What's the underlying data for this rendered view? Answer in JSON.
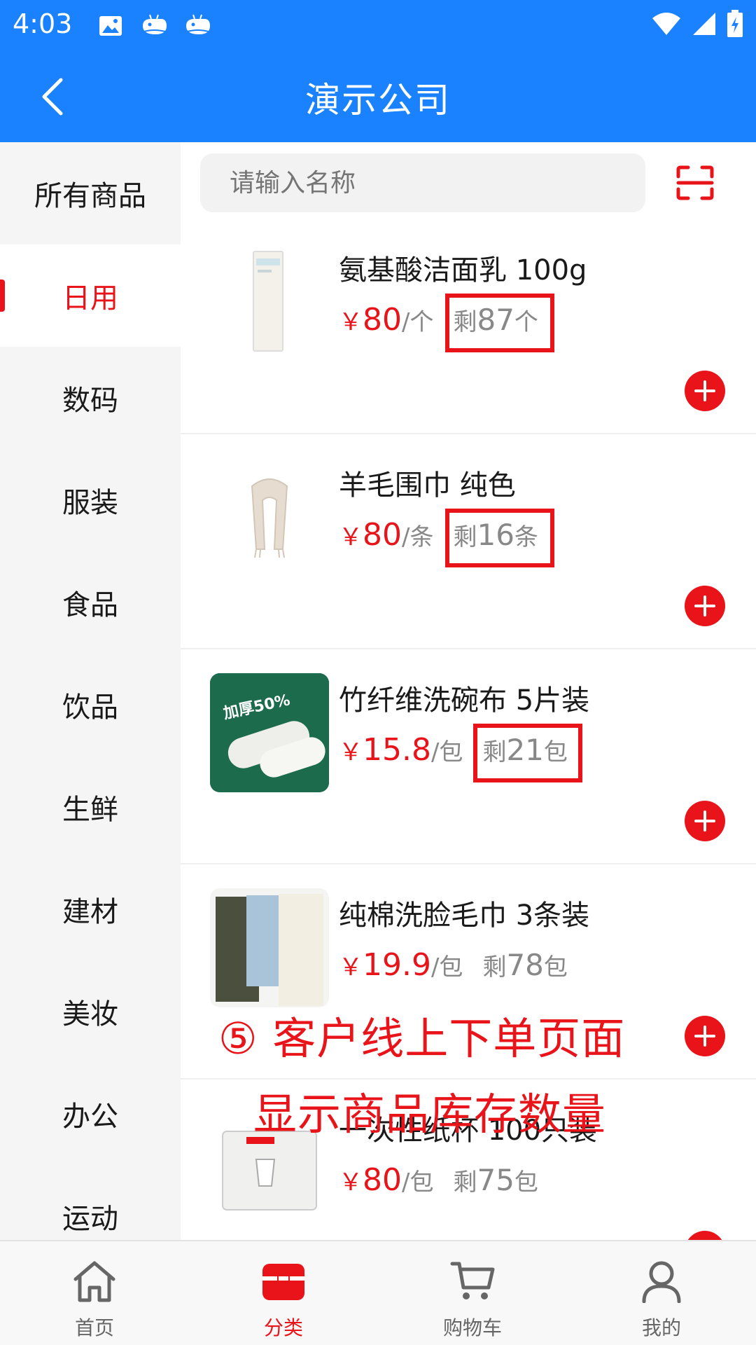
{
  "status_bar": {
    "time": "4:03"
  },
  "header": {
    "title": "演示公司"
  },
  "sidebar": {
    "items": [
      {
        "label": "所有商品",
        "active": false
      },
      {
        "label": "日用",
        "active": true
      },
      {
        "label": "数码",
        "active": false
      },
      {
        "label": "服装",
        "active": false
      },
      {
        "label": "食品",
        "active": false
      },
      {
        "label": "饮品",
        "active": false
      },
      {
        "label": "生鲜",
        "active": false
      },
      {
        "label": "建材",
        "active": false
      },
      {
        "label": "美妆",
        "active": false
      },
      {
        "label": "办公",
        "active": false
      },
      {
        "label": "运动",
        "active": false
      }
    ]
  },
  "search": {
    "placeholder": "请输入名称"
  },
  "products": [
    {
      "name": "氨基酸洁面乳 100g",
      "currency": "￥",
      "price": "80",
      "unit": "/个",
      "stock_prefix": "剩",
      "stock_num": "87",
      "stock_unit": "个",
      "image": "cleanser-tube"
    },
    {
      "name": "羊毛围巾 纯色",
      "currency": "￥",
      "price": "80",
      "unit": "/条",
      "stock_prefix": "剩",
      "stock_num": "16",
      "stock_unit": "条",
      "image": "scarf"
    },
    {
      "name": "竹纤维洗碗布 5片装",
      "currency": "￥",
      "price": "15.8",
      "unit": "/包",
      "stock_prefix": "剩",
      "stock_num": "21",
      "stock_unit": "包",
      "image": "dish-cloth",
      "image_text": "加厚50%"
    },
    {
      "name": "纯棉洗脸毛巾 3条装",
      "currency": "￥",
      "price": "19.9",
      "unit": "/包",
      "stock_prefix": "剩",
      "stock_num": "78",
      "stock_unit": "包",
      "image": "towels"
    },
    {
      "name": "一次性纸杯 100只装",
      "currency": "￥",
      "price": "80",
      "unit": "/包",
      "stock_prefix": "剩",
      "stock_num": "75",
      "stock_unit": "包",
      "image": "paper-cups"
    }
  ],
  "annotation": {
    "line1": "⑤ 客户线上下单页面",
    "line2": "显示商品库存数量",
    "color": "#e8141a"
  },
  "tabbar": {
    "items": [
      {
        "label": "首页",
        "icon": "home-icon",
        "active": false
      },
      {
        "label": "分类",
        "icon": "category-icon",
        "active": true
      },
      {
        "label": "购物车",
        "icon": "cart-icon",
        "active": false
      },
      {
        "label": "我的",
        "icon": "user-icon",
        "active": false
      }
    ]
  },
  "colors": {
    "primary": "#1a82ff",
    "accent": "#e8141a"
  }
}
